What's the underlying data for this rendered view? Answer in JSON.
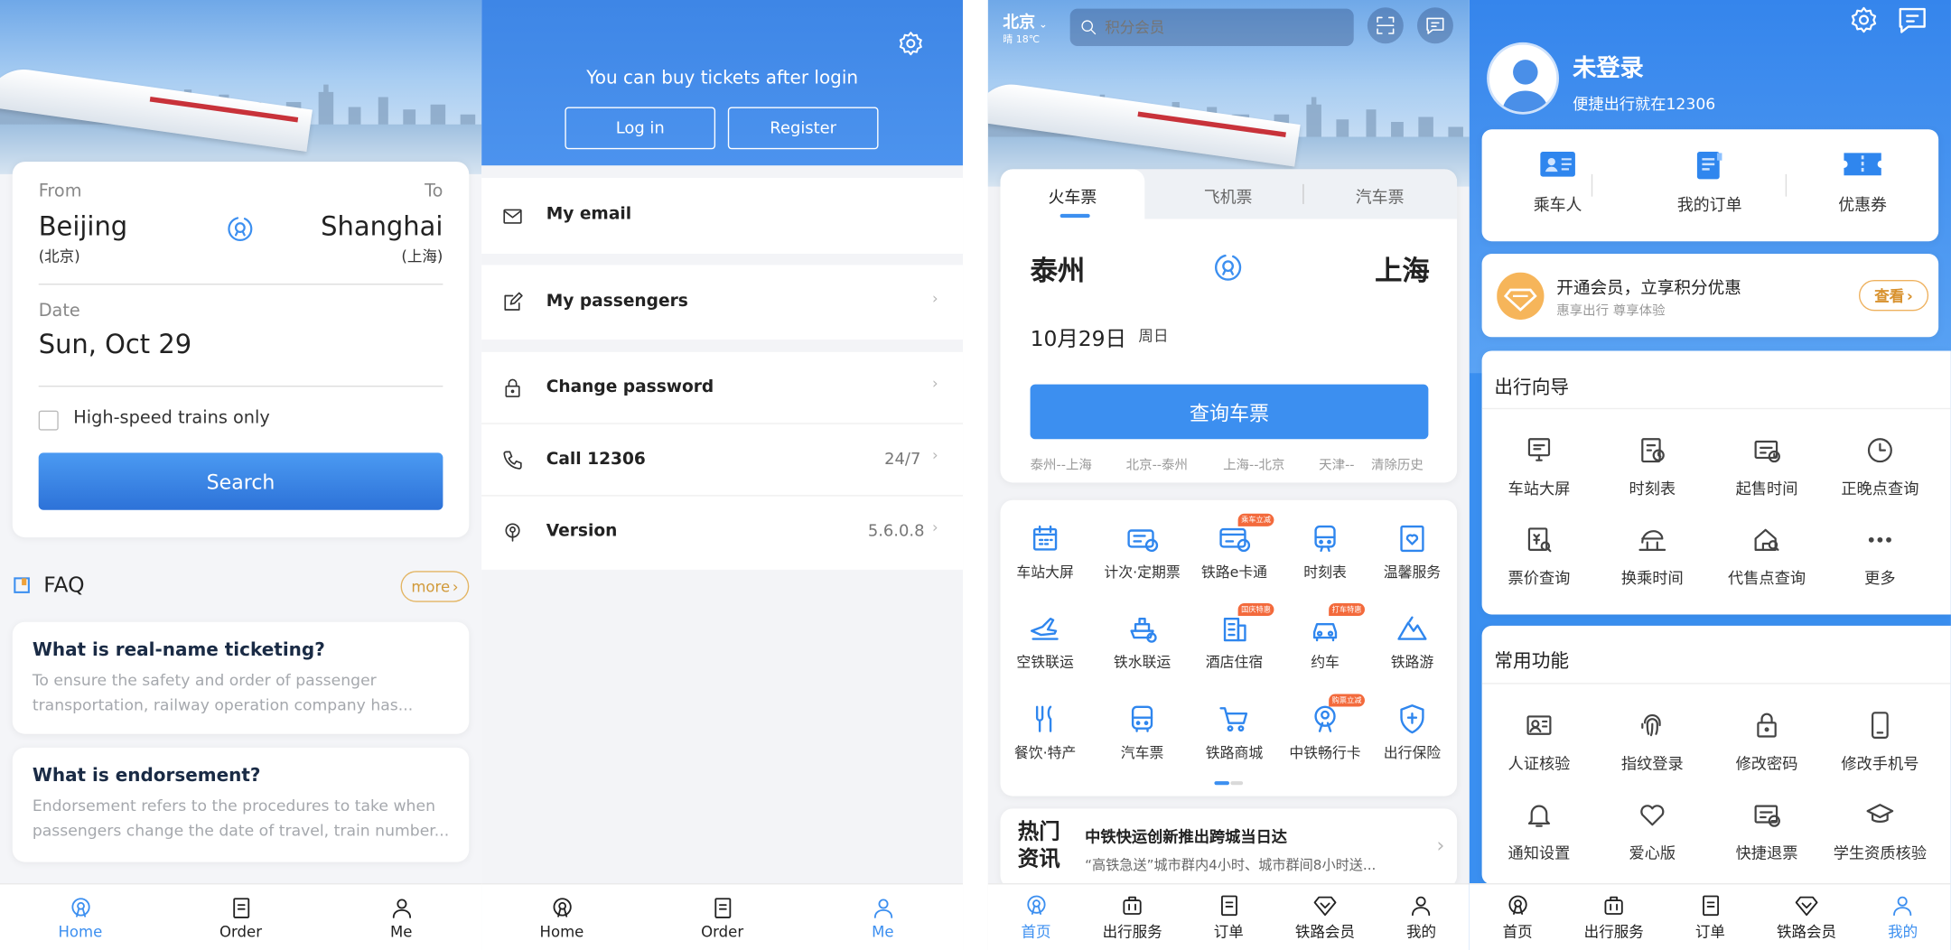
{
  "p1": {
    "from_label": "From",
    "to_label": "To",
    "from_city": "Beijing",
    "from_city_cn": "(北京)",
    "to_city": "Shanghai",
    "to_city_cn": "(上海)",
    "date_label": "Date",
    "date_value": "Sun, Oct 29",
    "highspeed_label": "High-speed trains only",
    "search_button": "Search",
    "faq_title": "FAQ",
    "more_label": "more",
    "faq": [
      {
        "q": "What is real-name ticketing?",
        "a1": "To ensure the safety and order of passenger",
        "a2": "transportation, railway operation company has..."
      },
      {
        "q": "What is endorsement?",
        "a1": "Endorsement refers to the procedures to take when",
        "a2": "passengers change the date of travel, train number..."
      }
    ],
    "nav": [
      "Home",
      "Order",
      "Me"
    ]
  },
  "p2": {
    "login_prompt": "You can buy tickets after login",
    "login_button": "Log in",
    "register_button": "Register",
    "menu": [
      {
        "label": "My email"
      },
      {
        "label": "My passengers"
      },
      {
        "label": "Change password"
      },
      {
        "label": "Call 12306",
        "value": "24/7"
      },
      {
        "label": "Version",
        "value": "5.6.0.8"
      }
    ],
    "nav": [
      "Home",
      "Order",
      "Me"
    ]
  },
  "p3": {
    "city": "北京",
    "weather": "晴 18℃",
    "search_placeholder": "积分会员",
    "tabs": [
      "火车票",
      "飞机票",
      "汽车票"
    ],
    "from_station": "泰州",
    "to_station": "上海",
    "date": "10月29日",
    "weekday": "周日",
    "query_button": "查询车票",
    "history": [
      "泰州--上海",
      "北京--泰州",
      "上海--北京",
      "天津--",
      "清除历史"
    ],
    "services": [
      {
        "label": "车站大屏",
        "icon": "station-screen-icon"
      },
      {
        "label": "计次·定期票",
        "icon": "ticket-pass-icon"
      },
      {
        "label": "铁路e卡通",
        "icon": "ecard-icon",
        "tag": "乘车立减"
      },
      {
        "label": "时刻表",
        "icon": "train-timetable-icon"
      },
      {
        "label": "温馨服务",
        "icon": "warm-service-icon"
      },
      {
        "label": "空铁联运",
        "icon": "air-rail-icon"
      },
      {
        "label": "铁水联运",
        "icon": "ship-rail-icon"
      },
      {
        "label": "酒店住宿",
        "icon": "hotel-icon",
        "tag": "国庆特惠"
      },
      {
        "label": "约车",
        "icon": "car-icon",
        "tag": "打车特惠"
      },
      {
        "label": "铁路游",
        "icon": "mountain-travel-icon"
      },
      {
        "label": "餐饮·特产",
        "icon": "dining-icon"
      },
      {
        "label": "汽车票",
        "icon": "bus-icon"
      },
      {
        "label": "铁路商城",
        "icon": "shopping-cart-icon"
      },
      {
        "label": "中铁畅行卡",
        "icon": "rail-card-icon",
        "tag": "购票立减"
      },
      {
        "label": "出行保险",
        "icon": "insurance-icon"
      }
    ],
    "news_badge": [
      "热门",
      "资讯"
    ],
    "news_title": "中铁快运创新推出跨城当日达",
    "news_text": "“高铁急送”城市群内4小时、城市群间8小时送...",
    "nav": [
      "首页",
      "出行服务",
      "订单",
      "铁路会员",
      "我的"
    ]
  },
  "p4": {
    "user_name": "未登录",
    "user_sub": "便捷出行就在12306",
    "quick": [
      "乘车人",
      "我的订单",
      "优惠券"
    ],
    "vip_title": "开通会员，立享积分优惠",
    "vip_sub": "惠享出行 尊享体验",
    "vip_button": "查看",
    "guide_title": "出行向导",
    "guide": [
      {
        "label": "车站大屏",
        "icon": "screen-icon"
      },
      {
        "label": "时刻表",
        "icon": "timetable-icon"
      },
      {
        "label": "起售时间",
        "icon": "sale-time-icon"
      },
      {
        "label": "正晚点查询",
        "icon": "clock-icon"
      },
      {
        "label": "票价查询",
        "icon": "fare-search-icon"
      },
      {
        "label": "换乘时间",
        "icon": "transfer-icon"
      },
      {
        "label": "代售点查询",
        "icon": "agency-search-icon"
      },
      {
        "label": "更多",
        "icon": "more-dots-icon"
      }
    ],
    "common_title": "常用功能",
    "common": [
      {
        "label": "人证核验",
        "icon": "id-verify-icon"
      },
      {
        "label": "指纹登录",
        "icon": "fingerprint-icon"
      },
      {
        "label": "修改密码",
        "icon": "lock-icon"
      },
      {
        "label": "修改手机号",
        "icon": "phone-icon"
      },
      {
        "label": "通知设置",
        "icon": "bell-icon"
      },
      {
        "label": "爱心版",
        "icon": "heart-icon"
      },
      {
        "label": "快捷退票",
        "icon": "refund-icon"
      },
      {
        "label": "学生资质核验",
        "icon": "student-cap-icon"
      }
    ],
    "nav": [
      "首页",
      "出行服务",
      "订单",
      "铁路会员",
      "我的"
    ]
  }
}
